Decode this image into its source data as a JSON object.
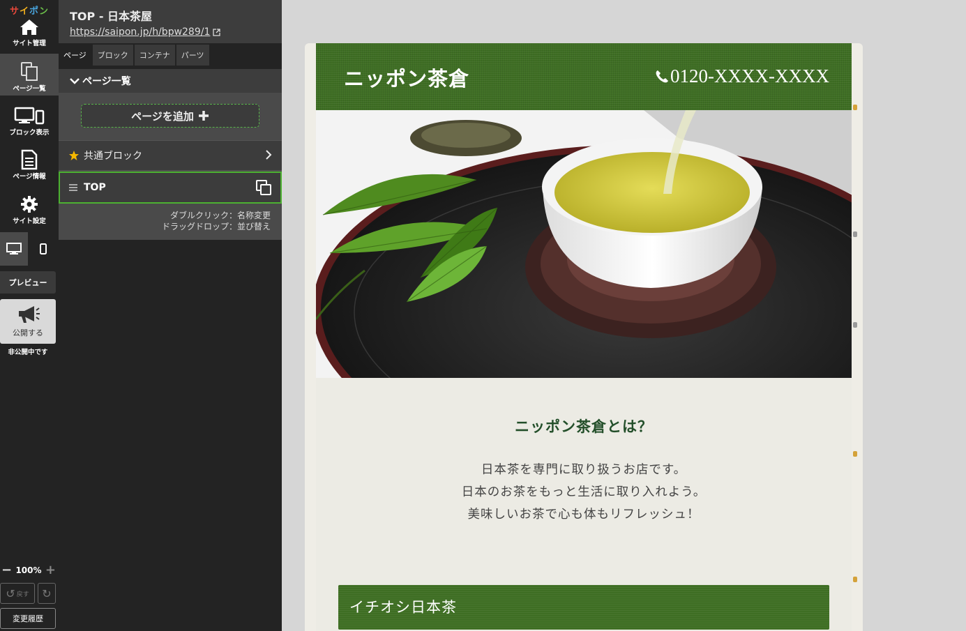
{
  "rail": {
    "logo": [
      "サ",
      "イ",
      "ポ",
      "ン"
    ],
    "logo_colors": [
      "#e8483b",
      "#f2b01e",
      "#49a6e0",
      "#6cc04a"
    ],
    "items": [
      {
        "label": "サイト管理",
        "icon": "home-icon"
      },
      {
        "label": "ページ一覧",
        "icon": "pages-icon"
      },
      {
        "label": "ブロック表示",
        "icon": "devices-icon"
      },
      {
        "label": "ページ情報",
        "icon": "document-icon"
      },
      {
        "label": "サイト設定",
        "icon": "gear-icon"
      }
    ],
    "preview_label": "プレビュー",
    "publish_label": "公開する",
    "publish_status": "非公開中です",
    "zoom": "100%",
    "undo_label": "戻す",
    "history_label": "変更履歴"
  },
  "panel": {
    "title": "TOP - 日本茶屋",
    "url": "https://saipon.jp/h/bpw289/1",
    "tabs": [
      "ページ",
      "ブロック",
      "コンテナ",
      "パーツ"
    ],
    "list_heading": "ページ一覧",
    "add_page_label": "ページを追加",
    "common_block_label": "共通ブロック",
    "selected_page": "TOP",
    "hint_lines": [
      "ダブルクリック：名称変更",
      "ドラッグドロップ：並び替え"
    ]
  },
  "site": {
    "name": "ニッポン茶倉",
    "tel": "0120-XXXX-XXXX",
    "about_title": "ニッポン茶倉とは？",
    "about_lines": [
      "日本茶を専門に取り扱うお店です。",
      "日本のお茶をもっと生活に取り入れよう。",
      "美味しいお茶で心も体もリフレッシュ！"
    ],
    "recommend_title": "イチオシ日本茶",
    "header_color": "#3e6e23",
    "heading_color": "#234f2a"
  }
}
